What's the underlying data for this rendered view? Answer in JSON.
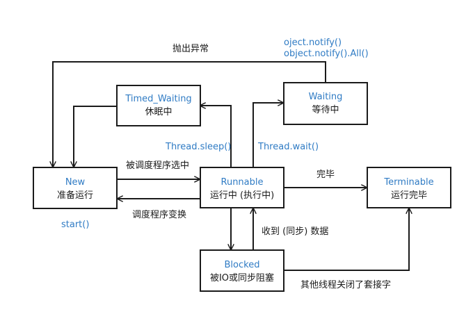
{
  "states": {
    "new": {
      "name": "New",
      "desc": "准备运行"
    },
    "runnable": {
      "name": "Runnable",
      "desc": "运行中 (执行中)"
    },
    "timed_waiting": {
      "name": "Timed_Waiting",
      "desc": "休眠中"
    },
    "waiting": {
      "name": "Waiting",
      "desc": "等待中"
    },
    "blocked": {
      "name": "Blocked",
      "desc": "被IO或同步阻塞"
    },
    "terminable": {
      "name": "Terminable",
      "desc": "运行完毕"
    }
  },
  "transitions": {
    "throw_exception": "抛出异常",
    "notify": "oject.notify()",
    "notify_all": "object.notify().All()",
    "thread_sleep": "Thread.sleep()",
    "thread_wait": "Thread.wait()",
    "scheduled": "被调度程序选中",
    "sched_changed": "调度程序变换",
    "start": "start()",
    "finished": "完毕",
    "received_data": "收到 (同步) 数据",
    "socket_closed": "其他线程关闭了套接字"
  },
  "colors": {
    "state_name": "#2f7bc4",
    "method_label": "#2f7bc4",
    "line": "#1a1a1a"
  }
}
